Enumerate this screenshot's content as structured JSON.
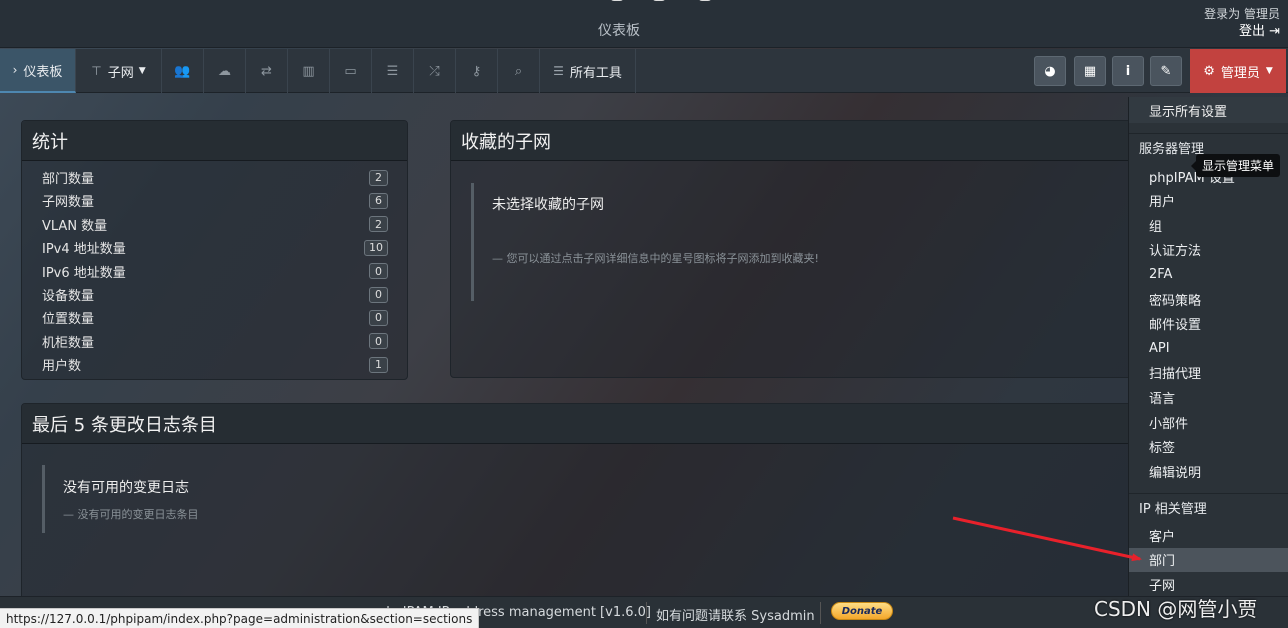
{
  "header": {
    "subtitle": "仪表板",
    "login_label": "登录为",
    "user_name": "管理员",
    "logout_label": "登出"
  },
  "nav": {
    "dashboard": "仪表板",
    "subnets": "子网",
    "all_tools": "所有工具",
    "admin": "管理员"
  },
  "stats": {
    "title": "统计",
    "rows": [
      {
        "label": "部门数量",
        "value": "2"
      },
      {
        "label": "子网数量",
        "value": "6"
      },
      {
        "label": "VLAN 数量",
        "value": "2"
      },
      {
        "label": "IPv4 地址数量",
        "value": "10"
      },
      {
        "label": "IPv6 地址数量",
        "value": "0"
      },
      {
        "label": "设备数量",
        "value": "0"
      },
      {
        "label": "位置数量",
        "value": "0"
      },
      {
        "label": "机柜数量",
        "value": "0"
      },
      {
        "label": "用户数",
        "value": "1"
      }
    ]
  },
  "favourites": {
    "title": "收藏的子网",
    "empty_title": "未选择收藏的子网",
    "empty_hint": "— 您可以通过点击子网详细信息中的星号图标将子网添加到收藏夹!"
  },
  "changelog": {
    "title": "最后 5 条更改日志条目",
    "empty_title": "没有可用的变更日志",
    "empty_hint": "— 没有可用的变更日志条目"
  },
  "admin_menu": {
    "show_all": "显示所有设置",
    "tooltip": "显示管理菜单",
    "server_header": "服务器管理",
    "server_items": [
      "phpIPAM 设置",
      "用户",
      "组",
      "认证方法",
      "2FA",
      "密码策略",
      "邮件设置",
      "API",
      "扫描代理",
      "语言",
      "小部件",
      "标签",
      "编辑说明"
    ],
    "ip_header": "IP 相关管理",
    "ip_items": [
      "客户",
      "部门",
      "子网"
    ]
  },
  "footer": {
    "app_text": "phpIPAM IP address management [v1.6.0]",
    "contact_text": "如有问题请联系 Sysadmin",
    "donate_label": "Donate"
  },
  "status_url": "https://127.0.0.1/phpipam/index.php?page=administration&section=sections",
  "watermark": "CSDN @网管小贾",
  "colors": {
    "admin_red": "#c2423f",
    "active_blue": "#3b5568",
    "arrow_red": "#e8212b"
  }
}
